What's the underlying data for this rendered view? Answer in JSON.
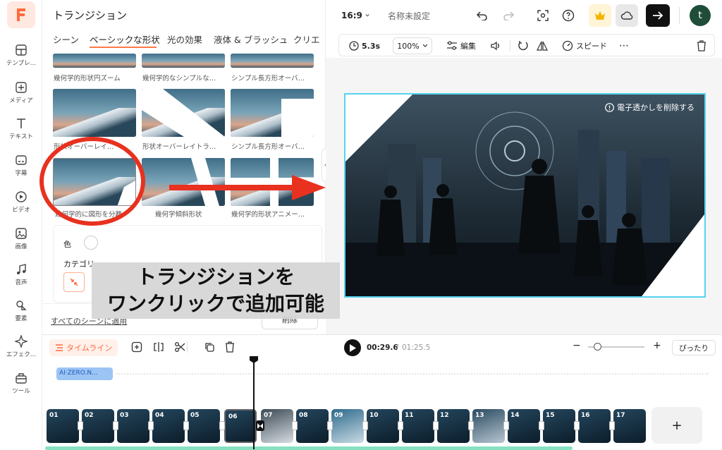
{
  "rail": {
    "items": [
      {
        "label": "テンプレ…",
        "icon": "template-icon"
      },
      {
        "label": "メディア",
        "icon": "media-add-icon"
      },
      {
        "label": "テキスト",
        "icon": "text-icon"
      },
      {
        "label": "字幕",
        "icon": "subtitle-icon"
      },
      {
        "label": "ビデオ",
        "icon": "video-icon"
      },
      {
        "label": "画像",
        "icon": "image-icon"
      },
      {
        "label": "音声",
        "icon": "music-icon"
      },
      {
        "label": "要素",
        "icon": "shapes-icon"
      },
      {
        "label": "エフェク…",
        "icon": "sparkle-icon"
      },
      {
        "label": "ツール",
        "icon": "toolbox-icon"
      }
    ]
  },
  "panel": {
    "title": "トランジション",
    "tabs": [
      "シーン",
      "ベーシックな形状",
      "光の効果",
      "液体 & ブラッシュ",
      "クリエ"
    ],
    "active_tab": "ベーシックな形状",
    "thumbs_row0": [
      "幾何学的形状円ズーム",
      "幾何学的なシンプルな…",
      "シンプル長方形オーバ…"
    ],
    "thumbs_row1": [
      "形状オーバーレイ…",
      "形状オーバーレイトラ…",
      "シンプル長方形オーバ…"
    ],
    "thumbs_row2": [
      "幾何学的に図形を分離",
      "幾何学傾斜形状",
      "幾何学的形状アニメー…"
    ],
    "color_label": "色",
    "category_label": "カテゴリ",
    "apply_all": "すべてのシーンに適用",
    "delete": "削除"
  },
  "topbar": {
    "ratio": "16:9",
    "project_name": "名称未設定",
    "avatar_initial": "t"
  },
  "toolbar": {
    "duration": "5.3s",
    "zoom": "100%",
    "edit": "編集",
    "speed": "スピード"
  },
  "preview": {
    "watermark": "電子透かしを削除する"
  },
  "annotation": {
    "line1": "トランジションを",
    "line2": "ワンクリックで追加可能"
  },
  "timeline": {
    "label": "タイムライン",
    "current": "00:29.6",
    "separator": "/",
    "total": "01:25.5",
    "fit": "ぴったり",
    "text_track": "AI·ZERO.N...",
    "clips": [
      "01",
      "02",
      "03",
      "04",
      "05",
      "06",
      "07",
      "08",
      "09",
      "10",
      "11",
      "12",
      "13",
      "14",
      "15",
      "16",
      "17"
    ],
    "add": "+"
  },
  "colors": {
    "accent": "#ff7a45",
    "selection": "#54d3f0",
    "annotation_red": "#e8311f"
  }
}
